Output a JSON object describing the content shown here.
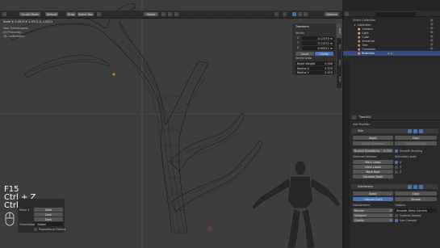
{
  "viewport_header": {
    "mode": "Sculpt Mode",
    "view_menu": "View",
    "left_button": "Default",
    "hash_button": "Drag",
    "select_button": "Select Box",
    "orient_label": "Global",
    "options_label": "Options"
  },
  "viewport_info": {
    "line1": "Scale X: 1.0013  Y: 1.0013  Z: 1.0013",
    "line2": "User Orthographic",
    "line3": "(0) Projection",
    "line4": "13 Centimeters"
  },
  "transform_panel": {
    "header": "Transform",
    "sub": "Vertex",
    "x_label": "X",
    "x_value": "-0.12375 m",
    "y_label": "Y",
    "y_value": "0.11272 m",
    "z_label": "Z",
    "z_value": "0.00311 m",
    "space_local": "Local",
    "space_global": "Global",
    "vertex_data_header": "Vertex Data",
    "bevel_weight_label": "Bevel Weight",
    "bevel_weight_value": "0.000",
    "radius_x_label": "Radius X",
    "radius_x_value": "0.370",
    "radius_y_label": "Radius Y",
    "radius_y_value": "0.370"
  },
  "n_tabs": [
    "Item",
    "Tool",
    "View",
    "Edit"
  ],
  "key_overlay": {
    "k1": "F15",
    "k2": "Ctrl + Z",
    "k3": "Ctrl + A"
  },
  "operator_panel": {
    "header": "Extrude Region and Move",
    "move_label": "Move X",
    "orient_label": "Orientation",
    "orient_value": "Global",
    "prop_edit_label": "Proportional Editing",
    "r1": "Dark",
    "r2": "Dark",
    "r3": "Dark"
  },
  "outliner": {
    "header": "Scene Collection",
    "items": [
      {
        "name": "Collection",
        "selected": false
      },
      {
        "name": "Camera",
        "selected": false
      },
      {
        "name": "Light",
        "selected": false
      },
      {
        "name": "Cube",
        "selected": false
      },
      {
        "name": "Armature",
        "selected": false
      },
      {
        "name": "Tree",
        "selected": false
      },
      {
        "name": "Character",
        "selected": false
      },
      {
        "name": "Branches",
        "selected": true
      }
    ]
  },
  "properties": {
    "object_name": "Tree.001",
    "modifiers_header": "Add Modifier",
    "mod1_name": "Skin",
    "mod1_btn_apply": "Apply",
    "mod1_btn_copy": "Copy",
    "mod1_btn_create_armature": "Create Armature",
    "mod1_btn_add_skin_data": "Add Skin Data",
    "branch_smoothing_label": "Branch Smoothing",
    "branch_smoothing_value": "0.000",
    "smooth_shading_label": "Smooth Shading",
    "selected_vertices_label": "Selected Vertices",
    "symmetry_axes_label": "Symmetry Axes",
    "mark_loose": "Mark Loose",
    "clear_loose": "Clear Loose",
    "mark_root": "Mark Root",
    "equalize_radii": "Equalize Radii",
    "axis_x": "X",
    "axis_y": "Y",
    "axis_z": "Z",
    "mod2_name": "Subdivision",
    "mod2_btn_apply": "Apply",
    "mod2_btn_copy": "Copy",
    "catmull_clark": "Catmull-Clark",
    "simple": "Simple",
    "subdivisions_label": "Subdivisions",
    "options_label": "Options",
    "render_label": "Render",
    "render_value": "2",
    "viewport_label": "Viewport",
    "viewport_value": "2",
    "quality_label": "Quality",
    "quality_value": "3",
    "uv_smooth_value": "Smooth, Keep Corners",
    "optimal_display": "Optimal Display",
    "use_creases": "Use Creases"
  }
}
